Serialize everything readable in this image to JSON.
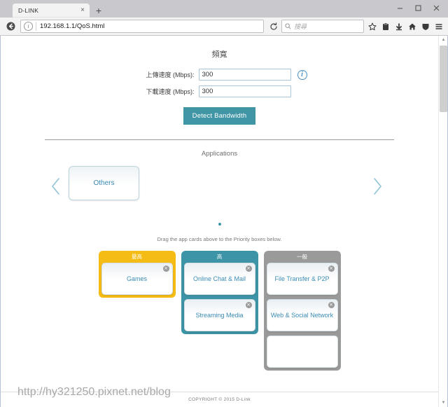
{
  "browser": {
    "tab": {
      "title": "D-LINK",
      "close_label": "×"
    },
    "new_tab_label": "+",
    "window_controls": {
      "minimize": "minimize-button",
      "maximize": "maximize-button",
      "close": "close-button"
    },
    "back_label": "←",
    "url": "192.168.1.1/QoS.html",
    "reload_label": "↻",
    "search_placeholder": "搜尋",
    "toolbar_icons": [
      "star-icon",
      "reader-icon",
      "download-icon",
      "home-icon",
      "shield-icon",
      "menu-icon"
    ]
  },
  "page": {
    "bandwidth": {
      "title": "頻寬",
      "fields": [
        {
          "label": "上傳速度 (Mbps):",
          "value": "300",
          "has_info": true
        },
        {
          "label": "下載速度 (Mbps):",
          "value": "300",
          "has_info": false
        }
      ],
      "detect_button": "Detect Bandwidth"
    },
    "applications": {
      "title": "Applications",
      "prev_label": "‹",
      "next_label": "›",
      "cards": [
        {
          "label": "Others"
        }
      ],
      "page_dots": 1,
      "hint": "Drag the app cards above to the Priority boxes below."
    },
    "priority_columns": [
      {
        "title": "最高",
        "color": "#f5bc15",
        "slots": [
          {
            "label": "Games",
            "empty": false,
            "close": "×"
          }
        ]
      },
      {
        "title": "高",
        "color": "#3d94a6",
        "slots": [
          {
            "label": "Online Chat & Mail",
            "empty": false,
            "close": "×"
          },
          {
            "label": "Streaming Media",
            "empty": false,
            "close": "×"
          }
        ]
      },
      {
        "title": "一般",
        "color": "#9a9a9a",
        "slots": [
          {
            "label": "File Transfer & P2P",
            "empty": false,
            "close": "×"
          },
          {
            "label": "Web & Social Network",
            "empty": false,
            "close": "×"
          },
          {
            "label": "",
            "empty": true,
            "close": ""
          }
        ]
      }
    ],
    "footer": "COPYRIGHT © 2015 D-Link",
    "watermark": "http://hy321250.pixnet.net/blog"
  }
}
